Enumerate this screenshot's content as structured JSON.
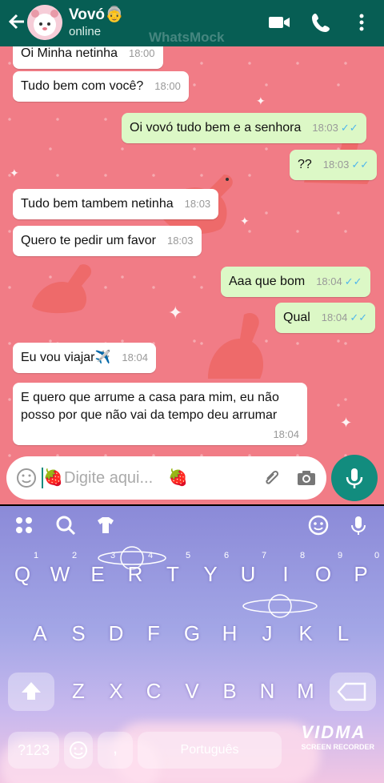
{
  "app": {
    "watermark": "WhatsMock"
  },
  "header": {
    "contact_name": "Vovó👵",
    "status": "online"
  },
  "messages": [
    {
      "dir": "in",
      "text": "Oi Minha netinha",
      "time": "18:00"
    },
    {
      "dir": "in",
      "text": "Tudo bem com você?",
      "time": "18:00"
    },
    {
      "dir": "out",
      "text": "Oi vovó tudo bem e a senhora",
      "time": "18:03",
      "ticks": "✓✓"
    },
    {
      "dir": "out",
      "text": "??",
      "time": "18:03",
      "ticks": "✓✓"
    },
    {
      "dir": "in",
      "text": "Tudo bem tambem netinha",
      "time": "18:03"
    },
    {
      "dir": "in",
      "text": "Quero te pedir um favor",
      "time": "18:03"
    },
    {
      "dir": "out",
      "text": "Aaa que bom",
      "time": "18:04",
      "ticks": "✓✓"
    },
    {
      "dir": "out",
      "text": "Qual",
      "time": "18:04",
      "ticks": "✓✓"
    },
    {
      "dir": "in",
      "text": "Eu vou viajar✈️",
      "time": "18:04"
    },
    {
      "dir": "in",
      "text": "E quero que arrume a casa para mim, eu não posso por que não vai da tempo deu arrumar",
      "time": "18:04"
    }
  ],
  "composer": {
    "prefix_emoji": "🍓",
    "placeholder": "Digite aqui...",
    "suffix_emoji": "🍓"
  },
  "keyboard": {
    "row1": [
      "Q",
      "W",
      "E",
      "R",
      "T",
      "Y",
      "U",
      "I",
      "O",
      "P"
    ],
    "row1_numbers": [
      "1",
      "2",
      "3",
      "4",
      "5",
      "6",
      "7",
      "8",
      "9",
      "0"
    ],
    "row2": [
      "A",
      "S",
      "D",
      "F",
      "G",
      "H",
      "J",
      "K",
      "L"
    ],
    "row3": [
      "Z",
      "X",
      "C",
      "V",
      "B",
      "N",
      "M"
    ],
    "symbols_key": "?123",
    "comma_key": ",",
    "space_label": "Português",
    "recorder_brand": "VIDMA",
    "recorder_sub": "SCREEN RECORDER"
  },
  "colors": {
    "header": "#075e54",
    "chat_bg": "#f17c86",
    "bubble_in": "#ffffff",
    "bubble_out": "#dcf8c6",
    "read_ticks": "#4fb6ec",
    "fab": "#128c7e"
  }
}
